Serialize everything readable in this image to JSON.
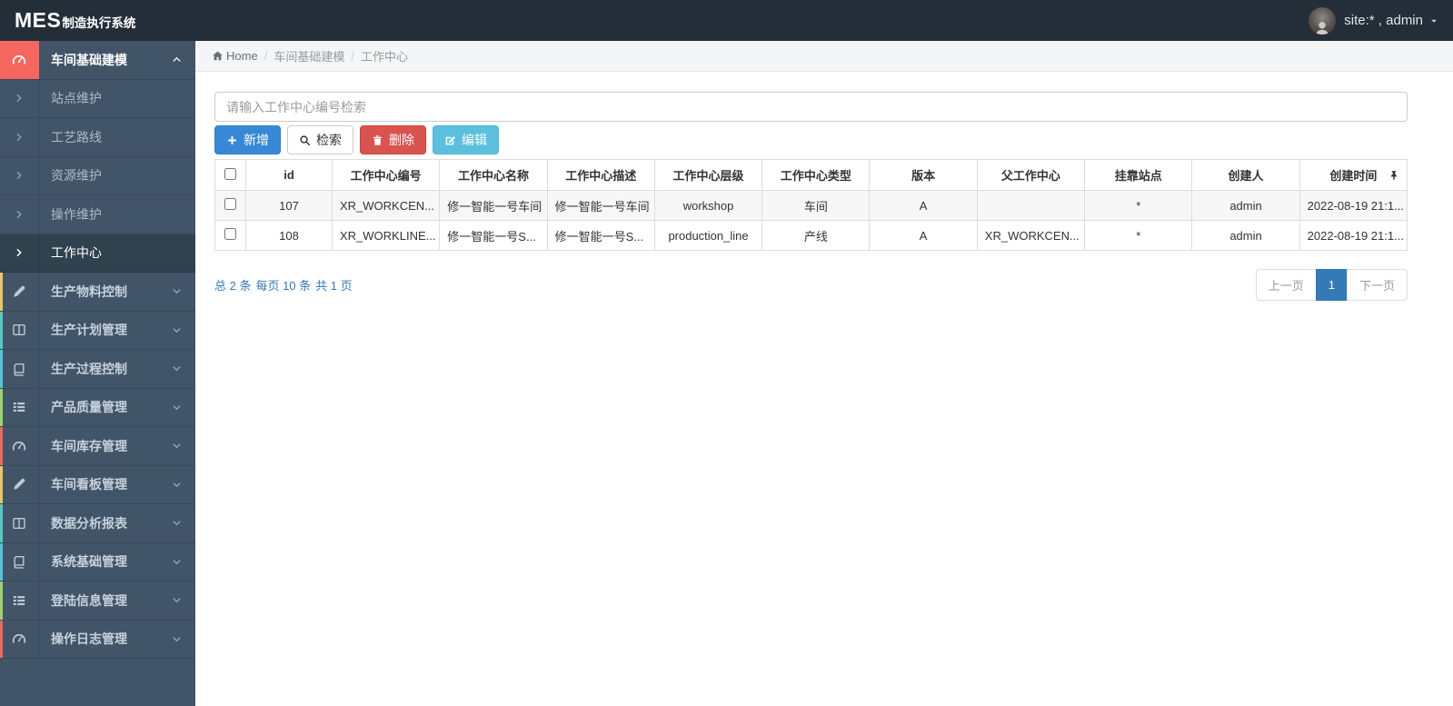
{
  "navbar": {
    "logo_main": "MES",
    "logo_sub": "制造执行系统",
    "user_label": "site:* , admin"
  },
  "breadcrumb": {
    "home": "Home",
    "section": "车间基础建模",
    "current": "工作中心"
  },
  "sidebar": {
    "items": [
      {
        "label": "车间基础建模",
        "icon": "tachometer",
        "expanded": true,
        "active": true,
        "children": [
          "站点维护",
          "工艺路线",
          "资源维护",
          "操作维护",
          "工作中心"
        ],
        "active_child": "工作中心"
      },
      {
        "label": "生产物料控制",
        "icon": "pencil"
      },
      {
        "label": "生产计划管理",
        "icon": "columns"
      },
      {
        "label": "生产过程控制",
        "icon": "book"
      },
      {
        "label": "产品质量管理",
        "icon": "list"
      },
      {
        "label": "车间库存管理",
        "icon": "tachometer"
      },
      {
        "label": "车间看板管理",
        "icon": "pencil"
      },
      {
        "label": "数据分析报表",
        "icon": "columns"
      },
      {
        "label": "系统基础管理",
        "icon": "book"
      },
      {
        "label": "登陆信息管理",
        "icon": "list"
      },
      {
        "label": "操作日志管理",
        "icon": "tachometer"
      }
    ]
  },
  "search": {
    "placeholder": "请输入工作中心编号检索",
    "value": ""
  },
  "toolbar": {
    "add": "新增",
    "search": "检索",
    "delete": "删除",
    "edit": "编辑"
  },
  "table": {
    "headers": [
      "id",
      "工作中心编号",
      "工作中心名称",
      "工作中心描述",
      "工作中心层级",
      "工作中心类型",
      "版本",
      "父工作中心",
      "挂靠站点",
      "创建人",
      "创建时间"
    ],
    "rows": [
      {
        "id": "107",
        "code": "XR_WORKCEN...",
        "name": "修一智能一号车间",
        "desc": "修一智能一号车间",
        "level": "workshop",
        "type": "车间",
        "version": "A",
        "parent": "",
        "station": "*",
        "creator": "admin",
        "created": "2022-08-19 21:1..."
      },
      {
        "id": "108",
        "code": "XR_WORKLINE...",
        "name": "修一智能一号S...",
        "desc": "修一智能一号S...",
        "level": "production_line",
        "type": "产线",
        "version": "A",
        "parent": "XR_WORKCEN...",
        "station": "*",
        "creator": "admin",
        "created": "2022-08-19 21:1..."
      }
    ]
  },
  "pagination": {
    "summary_total": "总 2 条",
    "summary_perpage": "每页 10 条",
    "summary_pages": "共 1 页",
    "prev": "上一页",
    "page": "1",
    "next": "下一页"
  },
  "colors": {
    "navbar_bg": "#232e38",
    "sidebar_bg": "#425568",
    "active_root_icon": "#f4665e",
    "primary": "#3789d8",
    "danger": "#d9534f",
    "info": "#5bc0de",
    "page_active": "#337ab7",
    "stripe_yellow": "#eac85e",
    "stripe_teal": "#53cbc0",
    "stripe_cyan": "#55c3db",
    "stripe_green": "#9ed36a",
    "stripe_red": "#f0655d"
  }
}
